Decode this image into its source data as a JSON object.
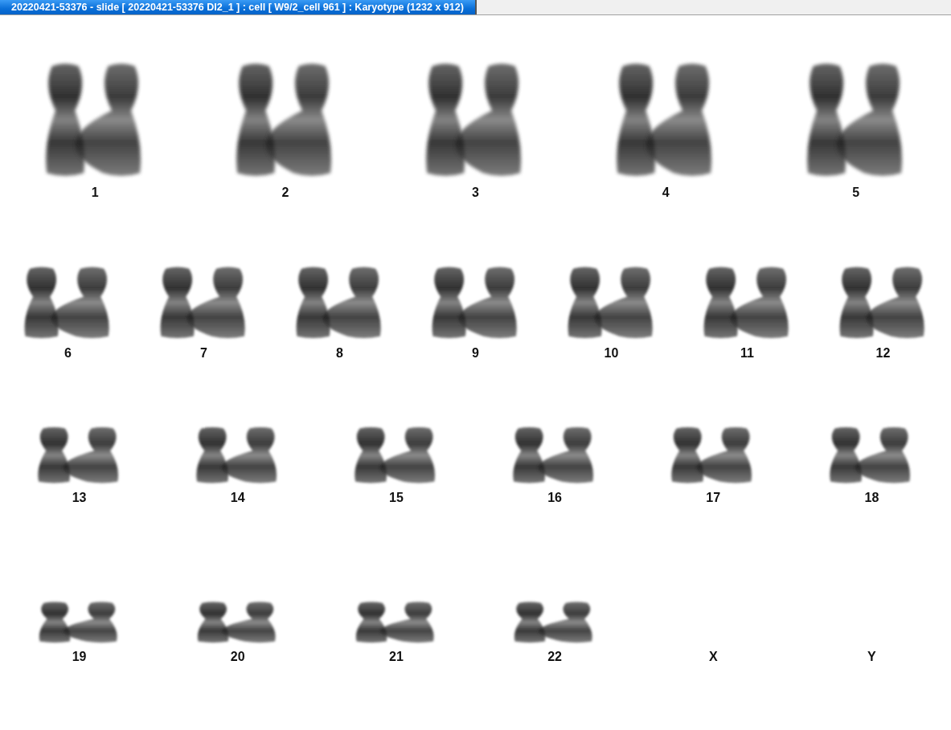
{
  "window": {
    "title": "20220421-53376 - slide [ 20220421-53376 DI2_1 ] : cell [ W9/2_cell 961 ] : Karyotype  (1232 x 912)"
  },
  "rows": [
    {
      "groups": [
        {
          "label": "1",
          "kind": "pair"
        },
        {
          "label": "2",
          "kind": "pair"
        },
        {
          "label": "3",
          "kind": "pair"
        },
        {
          "label": "4",
          "kind": "pair"
        },
        {
          "label": "5",
          "kind": "pair"
        }
      ]
    },
    {
      "groups": [
        {
          "label": "6",
          "kind": "pair"
        },
        {
          "label": "7",
          "kind": "pair"
        },
        {
          "label": "8",
          "kind": "pair"
        },
        {
          "label": "9",
          "kind": "pair"
        },
        {
          "label": "10",
          "kind": "pair"
        },
        {
          "label": "11",
          "kind": "pair"
        },
        {
          "label": "12",
          "kind": "pair"
        }
      ]
    },
    {
      "groups": [
        {
          "label": "13",
          "kind": "pair"
        },
        {
          "label": "14",
          "kind": "pair"
        },
        {
          "label": "15",
          "kind": "pair"
        },
        {
          "label": "16",
          "kind": "pair"
        },
        {
          "label": "17",
          "kind": "pair"
        },
        {
          "label": "18",
          "kind": "pair"
        }
      ]
    },
    {
      "groups": [
        {
          "label": "19",
          "kind": "pair"
        },
        {
          "label": "20",
          "kind": "pair"
        },
        {
          "label": "21",
          "kind": "pair"
        },
        {
          "label": "22",
          "kind": "pair"
        },
        {
          "label": "X",
          "kind": "empty"
        },
        {
          "label": "Y",
          "kind": "empty"
        }
      ]
    }
  ]
}
